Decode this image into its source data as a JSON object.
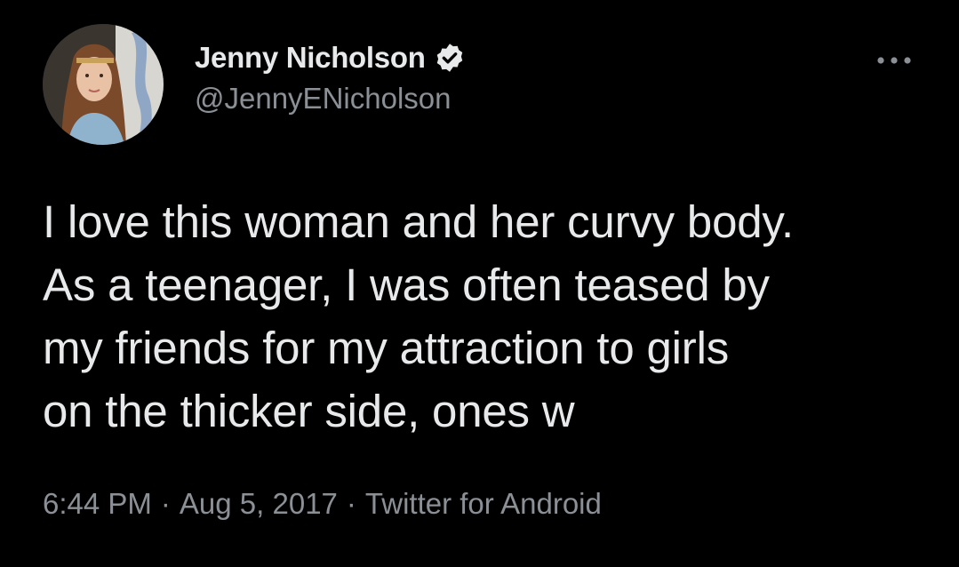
{
  "author": {
    "display_name": "Jenny Nicholson",
    "handle": "@JennyENicholson",
    "verified": true,
    "avatar_icon": "profile-photo"
  },
  "tweet": {
    "text": "I love this woman and her curvy body.\nAs a teenager, I was often teased by\nmy friends for my attraction to girls\non the thicker side, ones w"
  },
  "meta": {
    "time": "6:44 PM",
    "separator": "·",
    "date": "Aug 5, 2017",
    "source": "Twitter for Android"
  },
  "colors": {
    "background": "#000000",
    "text": "#e7e9ea",
    "secondary_text": "#8b9096",
    "verified_badge": "#e7e9ea"
  },
  "icons": {
    "more": "more-horizontal-icon",
    "verified": "verified-badge-icon"
  }
}
